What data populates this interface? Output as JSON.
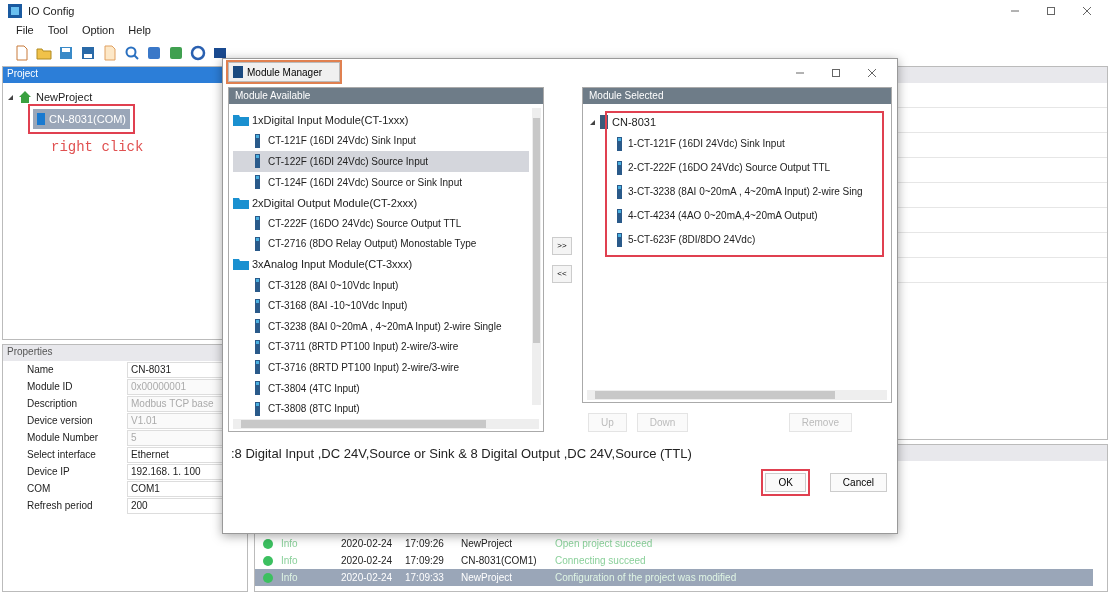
{
  "window": {
    "title": "IO Config"
  },
  "menu": [
    "File",
    "Tool",
    "Option",
    "Help"
  ],
  "project_panel": {
    "title": "Project",
    "tree": [
      {
        "label": "NewProject",
        "expanded": true,
        "selected": false,
        "children": [
          {
            "label": "CN-8031(COM)",
            "selected": true
          }
        ]
      }
    ]
  },
  "annotation": "right click",
  "properties": {
    "title": "Properties",
    "rows": [
      {
        "name": "Name",
        "value": "CN-8031",
        "disabled": false
      },
      {
        "name": "Module ID",
        "value": "0x00000001",
        "disabled": true
      },
      {
        "name": "Description",
        "value": "Modbus TCP base",
        "disabled": true
      },
      {
        "name": "Device version",
        "value": "V1.01",
        "disabled": true
      },
      {
        "name": "Module Number",
        "value": "5",
        "disabled": true
      },
      {
        "name": "Select interface",
        "value": "Ethernet",
        "disabled": false
      },
      {
        "name": "Device IP",
        "value": "192.168. 1. 100",
        "disabled": false
      },
      {
        "name": "COM",
        "value": "COM1",
        "disabled": false
      },
      {
        "name": "Refresh period",
        "value": "200",
        "disabled": false
      }
    ]
  },
  "log": {
    "rows": [
      {
        "level": "Info",
        "date": "2020-02-24",
        "time": "17:09:26",
        "source": "NewProject",
        "message": "Open project succeed",
        "selected": false
      },
      {
        "level": "Info",
        "date": "2020-02-24",
        "time": "17:09:29",
        "source": "CN-8031(COM1)",
        "message": "Connecting succeed",
        "selected": false
      },
      {
        "level": "Info",
        "date": "2020-02-24",
        "time": "17:09:33",
        "source": "NewProject",
        "message": "Configuration of the project was modified",
        "selected": true
      }
    ]
  },
  "context_menu": {
    "item": "Module Manager"
  },
  "dialog": {
    "available": {
      "title": "Module Available",
      "groups": [
        {
          "label": "1xDigital Input Module(CT-1xxx)",
          "items": [
            {
              "label": "CT-121F (16DI 24Vdc) Sink Input",
              "selected": false
            },
            {
              "label": "CT-122F (16DI 24Vdc) Source Input",
              "selected": true
            },
            {
              "label": "CT-124F (16DI 24Vdc) Source or Sink Input",
              "selected": false
            }
          ]
        },
        {
          "label": "2xDigital Output Module(CT-2xxx)",
          "items": [
            {
              "label": "CT-222F (16DO 24Vdc) Source Output TTL",
              "selected": false
            },
            {
              "label": "CT-2716 (8DO Relay Output) Monostable Type",
              "selected": false
            }
          ]
        },
        {
          "label": "3xAnalog Input Module(CT-3xxx)",
          "items": [
            {
              "label": "CT-3128 (8AI 0~10Vdc Input)",
              "selected": false
            },
            {
              "label": "CT-3168 (8AI -10~10Vdc Input)",
              "selected": false
            },
            {
              "label": "CT-3238 (8AI 0~20mA , 4~20mA Input) 2-wire Single",
              "selected": false
            },
            {
              "label": "CT-3711 (8RTD PT100 Input) 2-wire/3-wire",
              "selected": false
            },
            {
              "label": "CT-3716 (8RTD PT100 Input) 2-wire/3-wire",
              "selected": false
            },
            {
              "label": "CT-3804 (4TC Input)",
              "selected": false
            },
            {
              "label": "CT-3808 (8TC Input)",
              "selected": false
            }
          ]
        }
      ]
    },
    "move_buttons": [
      ">>",
      "<<"
    ],
    "selected_panel": {
      "title": "Module Selected",
      "root": "CN-8031",
      "expanded": true,
      "items": [
        "1-CT-121F (16DI 24Vdc) Sink Input",
        "2-CT-222F (16DO 24Vdc) Source Output TTL",
        "3-CT-3238 (8AI 0~20mA , 4~20mA Input) 2-wire Sing",
        "4-CT-4234 (4AO 0~20mA,4~20mA Output)",
        "5-CT-623F (8DI/8DO 24Vdc)"
      ]
    },
    "order_buttons": [
      {
        "label": "Up",
        "disabled": true
      },
      {
        "label": "Down",
        "disabled": true
      },
      {
        "label": "Remove",
        "disabled": true
      }
    ],
    "description": ":8 Digital Input ,DC 24V,Source or Sink & 8 Digital Output ,DC 24V,Source (TTL)",
    "buttons": [
      "OK",
      "Cancel"
    ]
  }
}
